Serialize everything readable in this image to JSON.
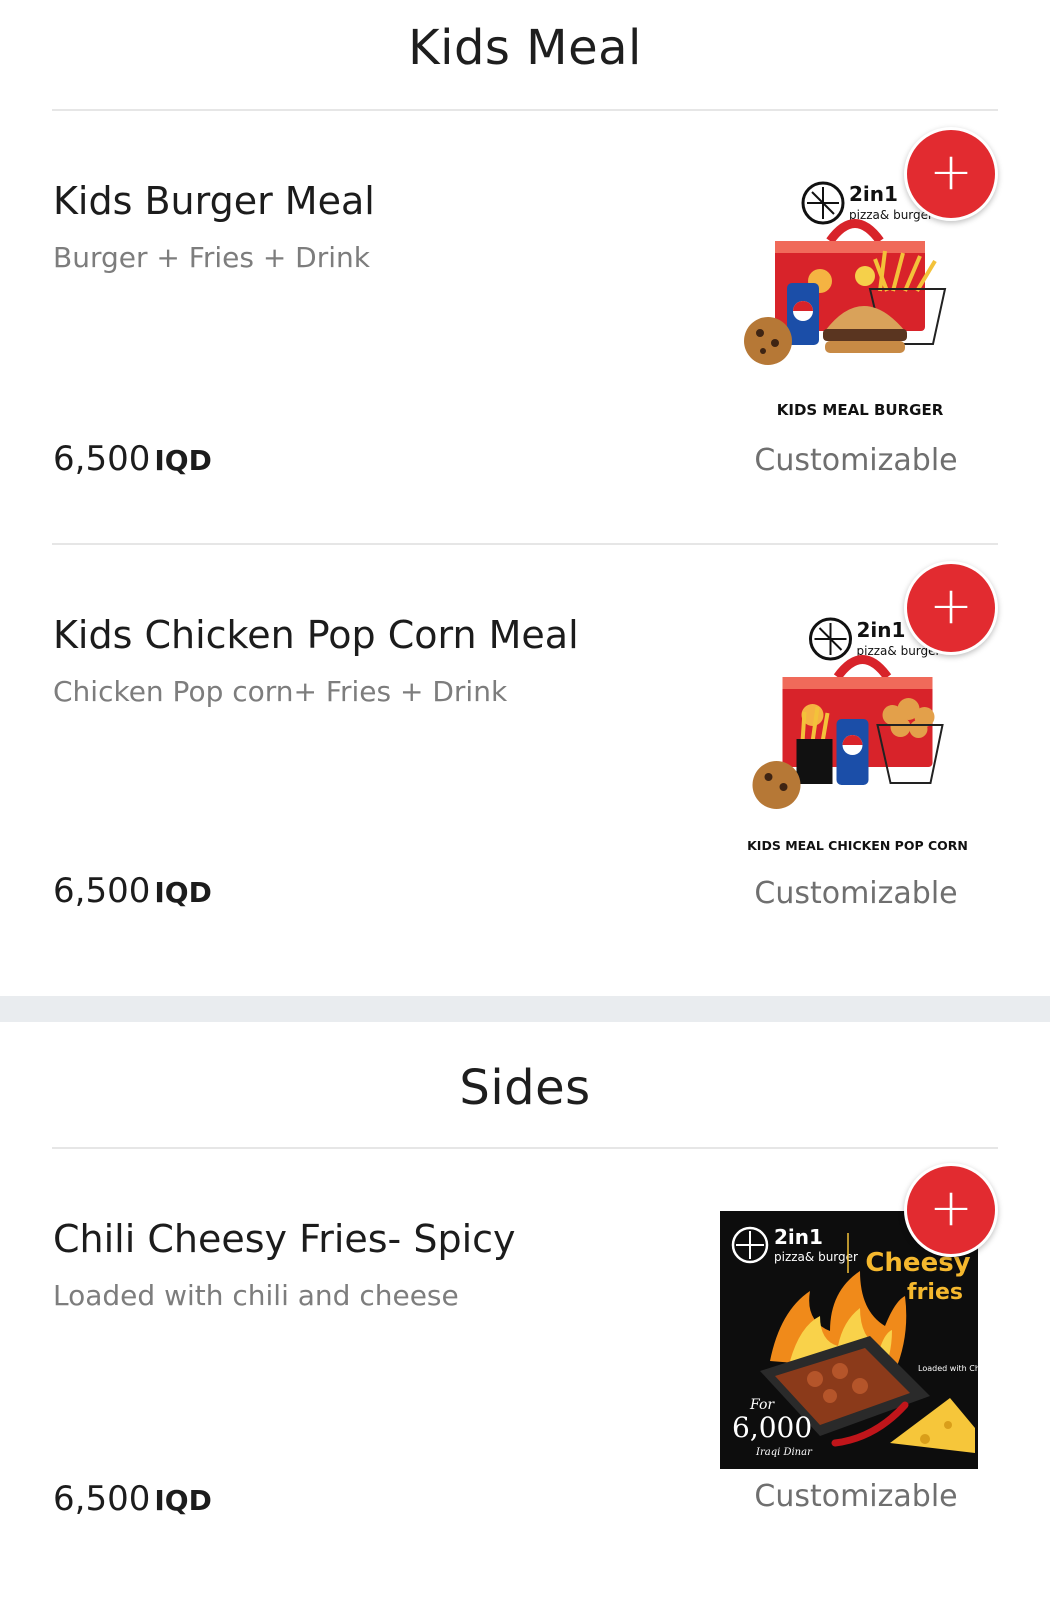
{
  "sections": [
    {
      "title": "Kids Meal",
      "items": [
        {
          "name": "Kids Burger Meal",
          "description": "Burger + Fries + Drink",
          "price": "6,500",
          "currency": "IQD",
          "tag": "Customizable",
          "image": {
            "brand": "2in1",
            "brand_sub": "pizza& burger",
            "caption": "KIDS MEAL BURGER"
          },
          "add_label": "+"
        },
        {
          "name": "Kids Chicken Pop Corn Meal",
          "description": "Chicken Pop corn+ Fries + Drink",
          "price": "6,500",
          "currency": "IQD",
          "tag": "Customizable",
          "image": {
            "brand": "2in1",
            "brand_sub": "pizza& burger",
            "caption": "KIDS MEAL CHICKEN POP CORN"
          },
          "add_label": "+"
        }
      ]
    },
    {
      "title": "Sides",
      "items": [
        {
          "name": "Chili Cheesy Fries- Spicy",
          "description": "Loaded with chili and cheese",
          "price": "6,500",
          "currency": "IQD",
          "tag": "Customizable",
          "image": {
            "brand": "2in1",
            "brand_sub": "pizza& burger",
            "headline_1": "Cheesy",
            "headline_2": "fries",
            "note": "Loaded with Chili and Cheese",
            "promo_for": "For",
            "promo_price": "6,000",
            "promo_currency": "Iraqi Dinar"
          },
          "add_label": "+"
        }
      ]
    }
  ],
  "colors": {
    "accent": "#e22b30",
    "divider": "#e6e6e6",
    "band": "#e9ecef"
  }
}
